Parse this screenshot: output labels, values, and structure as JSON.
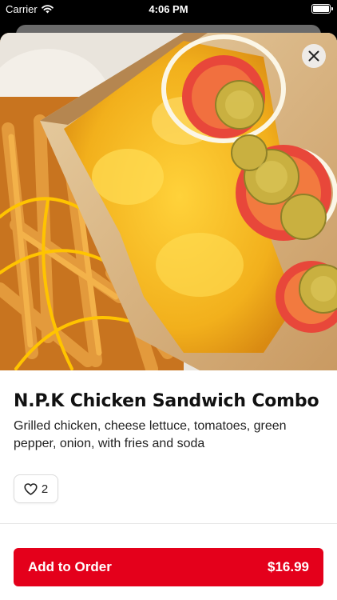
{
  "status_bar": {
    "carrier": "Carrier",
    "time": "4:06 PM"
  },
  "item": {
    "name": "N.P.K Chicken Sandwich Combo",
    "description": "Grilled chicken, cheese lettuce, tomatoes, green pepper, onion, with fries and soda",
    "like_count": "2"
  },
  "order_button": {
    "label": "Add to Order",
    "price": "$16.99"
  },
  "colors": {
    "accent": "#e4001b"
  },
  "icons": {
    "close": "close-icon",
    "like": "heart-outline-icon",
    "wifi": "wifi-icon",
    "battery": "battery-icon"
  }
}
